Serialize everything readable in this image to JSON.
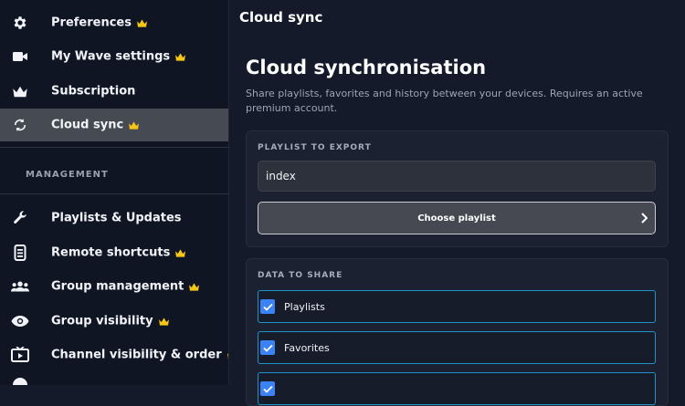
{
  "sidebar": {
    "items": [
      {
        "label": "Preferences",
        "icon": "gear-icon",
        "premium": true
      },
      {
        "label": "My Wave settings",
        "icon": "video-camera-icon",
        "premium": true
      },
      {
        "label": "Subscription",
        "icon": "crown-icon",
        "premium": false
      },
      {
        "label": "Cloud sync",
        "icon": "sync-icon",
        "premium": true,
        "active": true
      }
    ],
    "section_title": "MANAGEMENT",
    "management_items": [
      {
        "label": "Playlists & Updates",
        "icon": "wrench-icon",
        "premium": false
      },
      {
        "label": "Remote shortcuts",
        "icon": "remote-icon",
        "premium": true
      },
      {
        "label": "Group management",
        "icon": "group-icon",
        "premium": true
      },
      {
        "label": "Group visibility",
        "icon": "eye-icon",
        "premium": true
      },
      {
        "label": "Channel visibility & order",
        "icon": "tv-icon",
        "premium": true
      }
    ]
  },
  "header": {
    "title": "Cloud sync"
  },
  "main": {
    "title": "Cloud synchronisation",
    "description": "Share playlists, favorites and history between your devices. Requires an active premium account.",
    "export_card": {
      "label": "PLAYLIST TO EXPORT",
      "input_value": "index",
      "button_label": "Choose playlist"
    },
    "share_card": {
      "label": "DATA TO SHARE",
      "options": [
        {
          "label": "Playlists",
          "checked": true
        },
        {
          "label": "Favorites",
          "checked": true
        },
        {
          "label": "",
          "checked": true
        }
      ]
    }
  },
  "colors": {
    "accent": "#3b82f6",
    "crown": "#f5c518",
    "active_bg": "#464a52",
    "focus_border": "#1d93c9"
  }
}
